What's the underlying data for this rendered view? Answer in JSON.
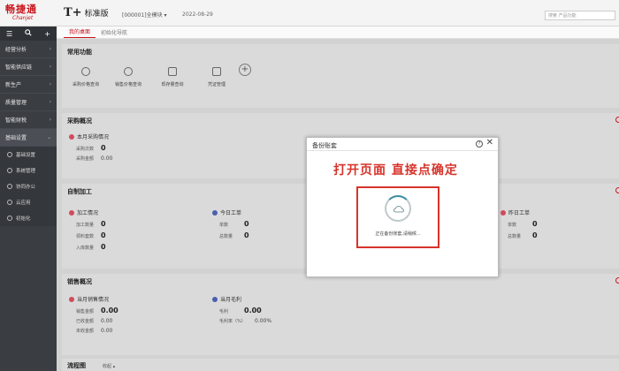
{
  "header": {
    "logo_cn": "畅捷通",
    "logo_en": "Chanjet",
    "brand_t": "T+",
    "brand_edition": "标准版",
    "account": "[000001]全模块 ▾",
    "date": "2022-08-29",
    "search_placeholder": "搜索 产品功能"
  },
  "sidebar": {
    "items": [
      {
        "label": "经营分析"
      },
      {
        "label": "智能供应链"
      },
      {
        "label": "新生产"
      },
      {
        "label": "质量管理"
      },
      {
        "label": "智能财税"
      },
      {
        "label": "基础设置"
      }
    ],
    "subitems": [
      {
        "label": "基础设置"
      },
      {
        "label": "系统管理"
      },
      {
        "label": "协同办公"
      },
      {
        "label": "云应用"
      },
      {
        "label": "初始化"
      }
    ]
  },
  "tabs": [
    {
      "label": "我的桌面"
    },
    {
      "label": "初始化导航"
    }
  ],
  "common": {
    "title": "常用功能",
    "items": [
      {
        "label": "采购价格查询"
      },
      {
        "label": "销售价格查询"
      },
      {
        "label": "现存量查询"
      },
      {
        "label": "凭证管理"
      }
    ],
    "add": "+"
  },
  "purchase": {
    "title": "采购概况",
    "card_title": "本月采购情况",
    "rows": [
      {
        "k": "采购次数",
        "v": "0"
      },
      {
        "k": "采购金额",
        "v": "0.00"
      }
    ]
  },
  "production": {
    "title": "自制加工",
    "card1": {
      "title": "加工情况",
      "rows": [
        {
          "k": "加工数量",
          "v": "0"
        },
        {
          "k": "领料套数",
          "v": "0"
        },
        {
          "k": "入库数量",
          "v": "0"
        }
      ]
    },
    "card2": {
      "title": "今日工单",
      "rows": [
        {
          "k": "单数",
          "v": "0"
        },
        {
          "k": "总数量",
          "v": "0"
        }
      ]
    },
    "card3": {
      "title": "昨日工单",
      "rows": [
        {
          "k": "单数",
          "v": "0"
        },
        {
          "k": "总数量",
          "v": "0"
        }
      ]
    }
  },
  "sales": {
    "title": "销售概况",
    "card1": {
      "title": "当月销售情况",
      "rows": [
        {
          "k": "销售金额",
          "v": "0.00"
        },
        {
          "k": "已收金额",
          "v": "0.00"
        },
        {
          "k": "未收金额",
          "v": "0.00"
        }
      ]
    },
    "card2": {
      "title": "当月毛利",
      "rows": [
        {
          "k": "毛利",
          "v": "0.00"
        },
        {
          "k": "毛利率（%）",
          "v": "0.00%"
        }
      ]
    }
  },
  "flow": {
    "title": "流程图",
    "toggle": "收起 ▴"
  },
  "modal": {
    "title": "备份账套",
    "help": "?",
    "close": "✕",
    "annotation": "打开页面 直接点确定",
    "progress_text": "正在备份账套,请稍候..."
  }
}
